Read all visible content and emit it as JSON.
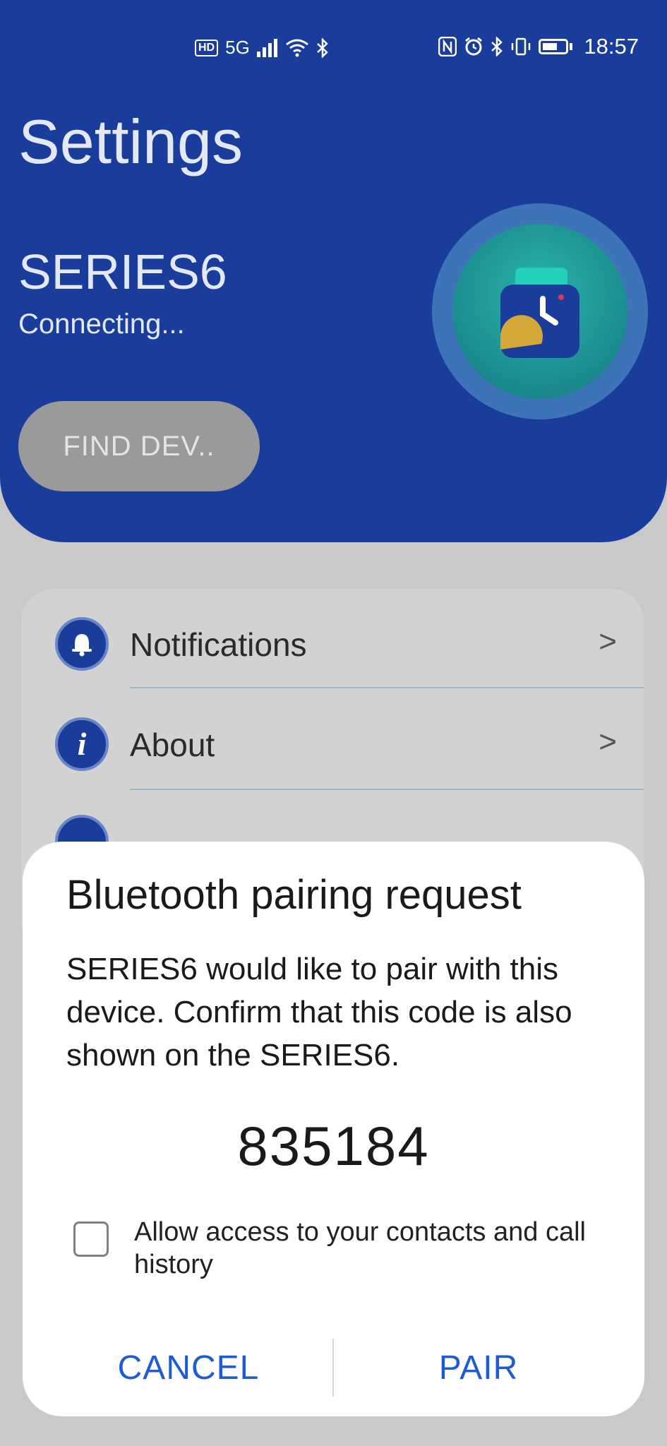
{
  "status_bar": {
    "left_badge": "HD",
    "network": "5G",
    "time": "18:57"
  },
  "header": {
    "title": "Settings",
    "device_name": "SERIES6",
    "device_status": "Connecting...",
    "find_button": "FIND DEV.."
  },
  "menu": {
    "items": [
      {
        "label": "Notifications",
        "icon": "bell-icon"
      },
      {
        "label": "About",
        "icon": "info-icon"
      }
    ]
  },
  "dialog": {
    "title": "Bluetooth pairing request",
    "message": "SERIES6 would like to pair with this device. Confirm that this code is also shown on the SERIES6.",
    "code": "835184",
    "checkbox_label": "Allow access to your contacts and call history",
    "checkbox_checked": false,
    "cancel_label": "CANCEL",
    "pair_label": "PAIR"
  },
  "colors": {
    "header_bg": "#1a3d9c",
    "accent": "#1f5bd1",
    "watch_teal": "#2bb4ab"
  }
}
